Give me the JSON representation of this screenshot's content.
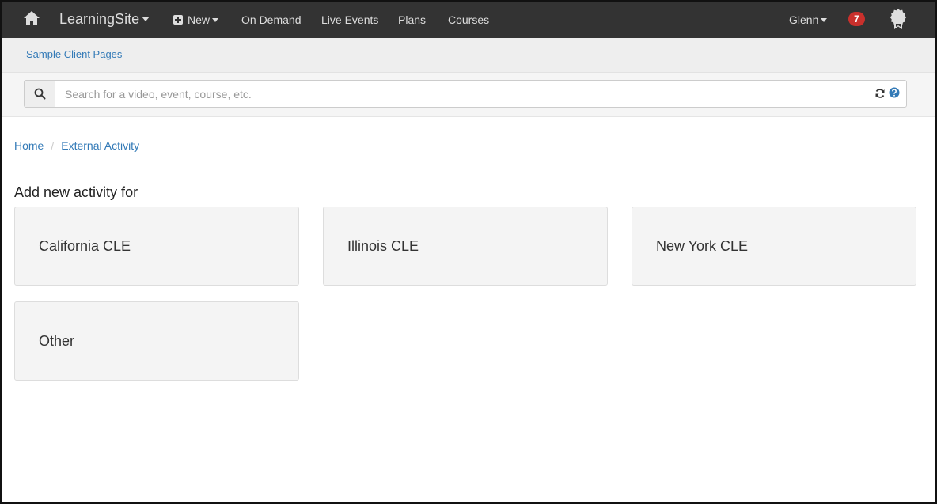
{
  "navbar": {
    "brand": "LearningSite",
    "new_label": "New",
    "links": [
      "On Demand",
      "Live Events",
      "Plans",
      "Courses"
    ],
    "user_name": "Glenn",
    "notification_count": "7",
    "icons": {
      "home": "home-icon",
      "new": "plus-square-icon",
      "award": "award-ribbon-icon"
    }
  },
  "subheader": {
    "link": "Sample Client Pages"
  },
  "search": {
    "placeholder": "Search for a video, event, course, etc.",
    "value": "",
    "icons": [
      "search-icon",
      "refresh-icon",
      "help-icon"
    ]
  },
  "breadcrumb": {
    "items": [
      "Home",
      "External Activity"
    ],
    "separator": "/"
  },
  "main": {
    "heading": "Add new activity for",
    "cards": [
      "California CLE",
      "Illinois CLE",
      "New York CLE",
      "Other"
    ]
  },
  "colors": {
    "navbar_bg": "#333333",
    "link": "#337ab7",
    "badge": "#c9302c",
    "card_bg": "#f4f4f4"
  }
}
